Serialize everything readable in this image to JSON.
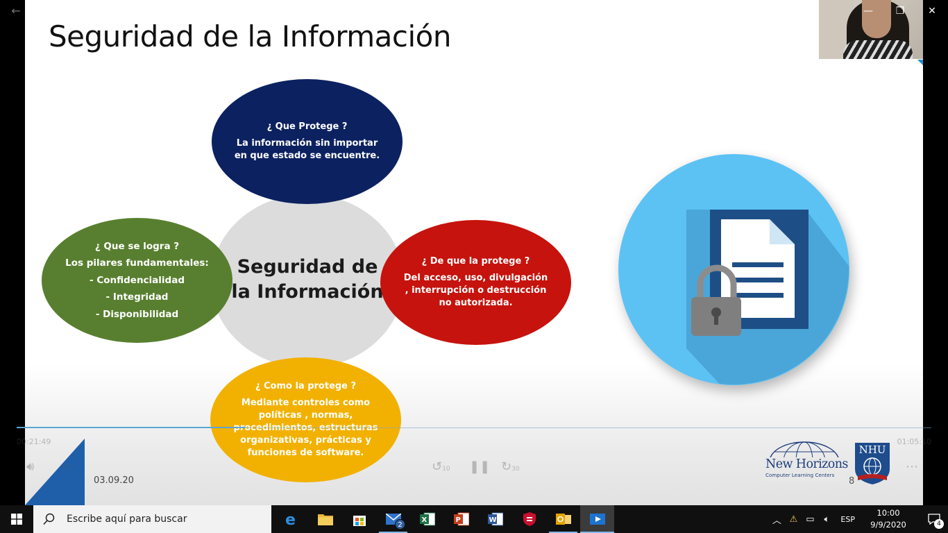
{
  "window": {
    "controls": {
      "minimize": "—",
      "restore": "❐",
      "close": "✕"
    },
    "back_glyph": "←"
  },
  "slide": {
    "title": "Seguridad de la Información",
    "center_line1": "Seguridad de",
    "center_line2": "la Información",
    "top": {
      "question": "¿ Que Protege ?",
      "line1": "La información sin importar",
      "line2": "en que estado se encuentre."
    },
    "left": {
      "question": "¿ Que se logra ?",
      "line1": "Los pilares fundamentales:",
      "item1": "- Confidencialidad",
      "item2": "- Integridad",
      "item3": "- Disponibilidad"
    },
    "right": {
      "question": "¿ De que la protege ?",
      "line1": "Del acceso, uso, divulgación",
      "line2": ", interrupción o destrucción",
      "line3": "no autorizada."
    },
    "bottom": {
      "question": "¿ Como la protege ?",
      "line1": "Mediante controles como",
      "line2": "políticas , normas,",
      "line3": "procedimientos, estructuras",
      "line4": "organizativas, prácticas y",
      "line5": "funciones de software."
    },
    "date": "03.09.20",
    "page_number": "8",
    "logo_text": "New Horizons",
    "logo_subtext": "Computer Learning Centers",
    "nhu_text": "NHU",
    "colors": {
      "top": "#0c2160",
      "left": "#587f2f",
      "right": "#c6130d",
      "bottom": "#f2b100",
      "center": "#dcdcdc",
      "lock_circle": "#5cc2f4"
    }
  },
  "video": {
    "time_elapsed": "00:21:49",
    "time_total": "01:05:10",
    "progress_fraction": 0.25,
    "icons": [
      "volume-icon",
      "captions-icon",
      "rewind-10-icon",
      "pause-icon",
      "forward-30-icon",
      "more-icon"
    ],
    "rewind_label": "10",
    "forward_label": "30"
  },
  "taskbar": {
    "search_placeholder": "Escribe aquí para buscar",
    "apps": [
      "edge",
      "file-explorer",
      "store",
      "mail",
      "excel",
      "powerpoint",
      "word",
      "security",
      "outlook",
      "video-player"
    ],
    "mail_badge": "2",
    "language": "ESP",
    "time": "10:00",
    "date": "9/9/2020",
    "notification_count": "4"
  }
}
